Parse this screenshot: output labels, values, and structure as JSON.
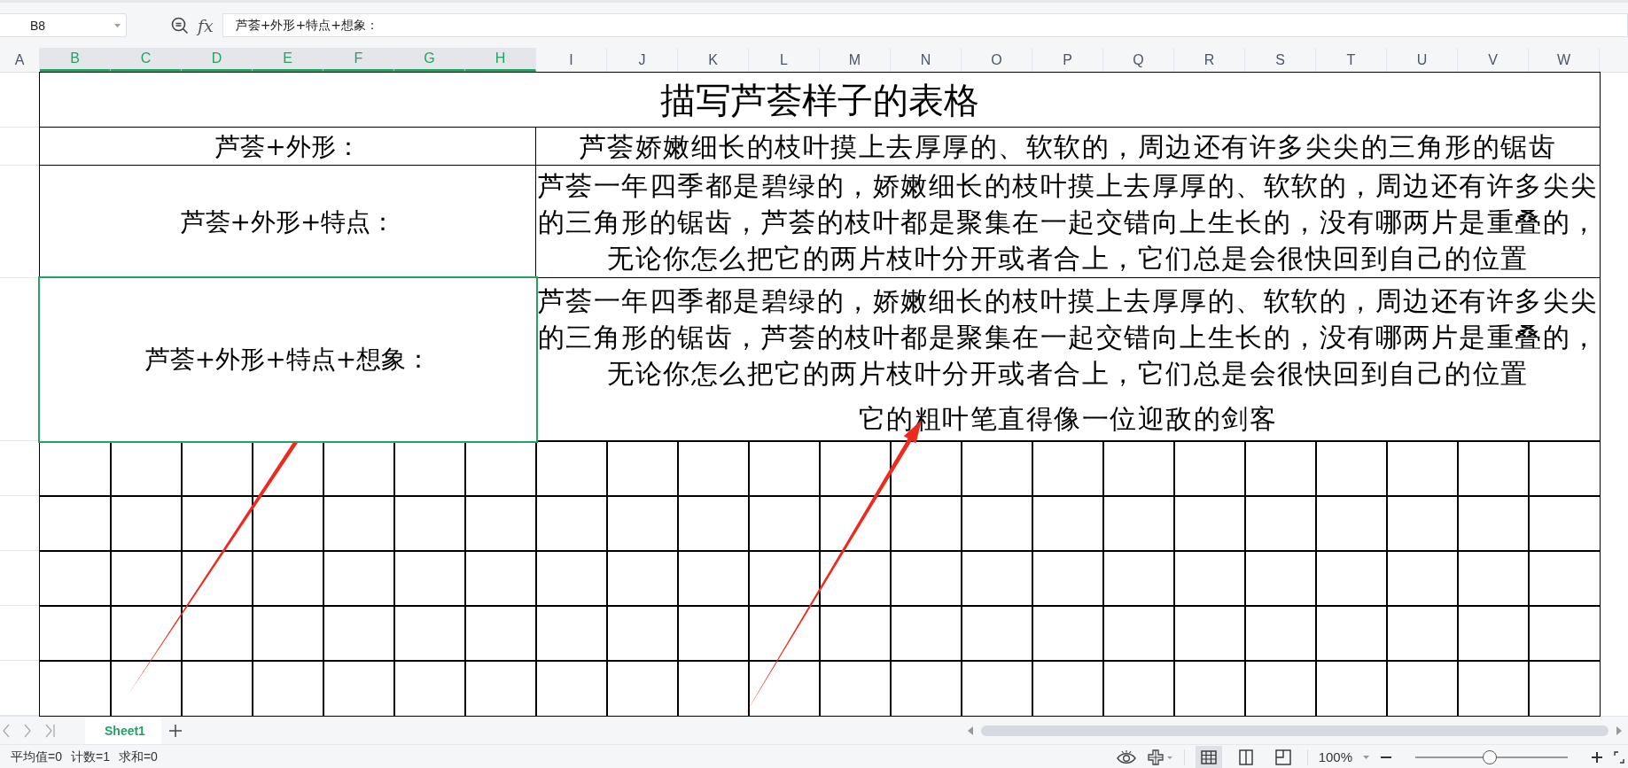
{
  "toolbar": {
    "name_box": "B8",
    "fx": "fx",
    "formula": "芦荟+外形+特点+想象："
  },
  "columns": [
    {
      "label": "A",
      "selected": false
    },
    {
      "label": "B",
      "selected": true
    },
    {
      "label": "C",
      "selected": true
    },
    {
      "label": "D",
      "selected": true
    },
    {
      "label": "E",
      "selected": true
    },
    {
      "label": "F",
      "selected": true
    },
    {
      "label": "G",
      "selected": true
    },
    {
      "label": "H",
      "selected": true
    },
    {
      "label": "I",
      "selected": false
    },
    {
      "label": "J",
      "selected": false
    },
    {
      "label": "K",
      "selected": false
    },
    {
      "label": "L",
      "selected": false
    },
    {
      "label": "M",
      "selected": false
    },
    {
      "label": "N",
      "selected": false
    },
    {
      "label": "O",
      "selected": false
    },
    {
      "label": "P",
      "selected": false
    },
    {
      "label": "Q",
      "selected": false
    },
    {
      "label": "R",
      "selected": false
    },
    {
      "label": "S",
      "selected": false
    },
    {
      "label": "T",
      "selected": false
    },
    {
      "label": "U",
      "selected": false
    },
    {
      "label": "V",
      "selected": false
    },
    {
      "label": "W",
      "selected": false
    }
  ],
  "sheet": {
    "title": "描写芦荟样子的表格",
    "rows": [
      {
        "label": "芦荟+外形：",
        "text": "芦荟娇嫩细长的枝叶摸上去厚厚的、软软的，周边还有许多尖尖的三角形的锯齿",
        "selected": false
      },
      {
        "label": "芦荟+外形+特点：",
        "text": "芦荟一年四季都是碧绿的，娇嫩细长的枝叶摸上去厚厚的、软软的，周边还有许多尖尖的三角形的锯齿，芦荟的枝叶都是聚集在一起交错向上生长的，没有哪两片是重叠的，无论你怎么把它的两片枝叶分开或者合上，它们总是会很快回到自己的位置",
        "selected": false
      },
      {
        "label": "芦荟+外形+特点+想象：",
        "text": "芦荟一年四季都是碧绿的，娇嫩细长的枝叶摸上去厚厚的、软软的，周边还有许多尖尖的三角形的锯齿，芦荟的枝叶都是聚集在一起交错向上生长的，没有哪两片是重叠的，无论你怎么把它的两片枝叶分开或者合上，它们总是会很快回到自己的位置",
        "extra": "它的粗叶笔直得像一位迎敌的剑客",
        "selected": true
      }
    ]
  },
  "sheet_tabs": [
    {
      "label": "Sheet1",
      "selected": true
    }
  ],
  "status_bar": {
    "stats": [
      "平均值=0",
      "计数=1",
      "求和=0"
    ],
    "views": [
      {
        "kind": "normal",
        "selected": true
      },
      {
        "kind": "page",
        "selected": false
      },
      {
        "kind": "break",
        "selected": false
      }
    ],
    "zoom": "100%",
    "zoom_slider": {
      "level": 0.49
    }
  }
}
